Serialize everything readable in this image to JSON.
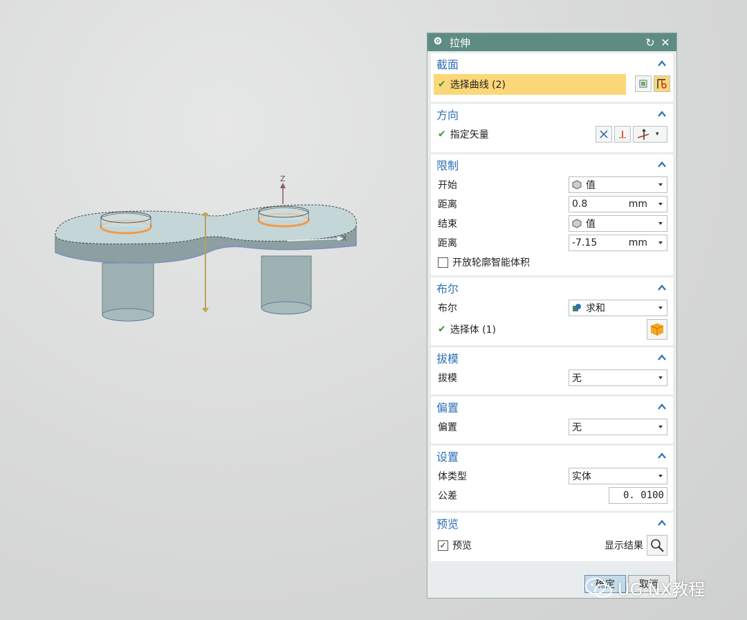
{
  "viewport": {
    "axis_z": "Z",
    "axis_x": "X"
  },
  "dialog": {
    "title": "拉伸",
    "sections": {
      "section": {
        "title": "截面",
        "select_curve": "选择曲线 (2)"
      },
      "direction": {
        "title": "方向",
        "specify_vector": "指定矢量"
      },
      "limits": {
        "title": "限制",
        "start_label": "开始",
        "start_value": "值",
        "distance1_label": "距离",
        "distance1_value": "0.8",
        "distance1_unit": "mm",
        "end_label": "结束",
        "end_value": "值",
        "distance2_label": "距离",
        "distance2_value": "-7.15",
        "distance2_unit": "mm",
        "open_profile_label": "开放轮廓智能体积"
      },
      "boolean": {
        "title": "布尔",
        "boolean_label": "布尔",
        "boolean_value": "求和",
        "select_body": "选择体 (1)"
      },
      "draft": {
        "title": "拔模",
        "draft_label": "拔模",
        "draft_value": "无"
      },
      "offset": {
        "title": "偏置",
        "offset_label": "偏置",
        "offset_value": "无"
      },
      "settings": {
        "title": "设置",
        "body_type_label": "体类型",
        "body_type_value": "实体",
        "tolerance_label": "公差",
        "tolerance_value": "0. 0100"
      },
      "preview": {
        "title": "预览",
        "preview_label": "预览",
        "show_result": "显示结果"
      }
    },
    "buttons": {
      "ok": "确定",
      "cancel": "取消"
    }
  },
  "watermark": {
    "text": "UG NX教程"
  },
  "colors": {
    "titlebar": "#5e8c82",
    "section_title": "#2e6fb5",
    "highlight": "#fcd778",
    "check": "#2f9a33"
  }
}
